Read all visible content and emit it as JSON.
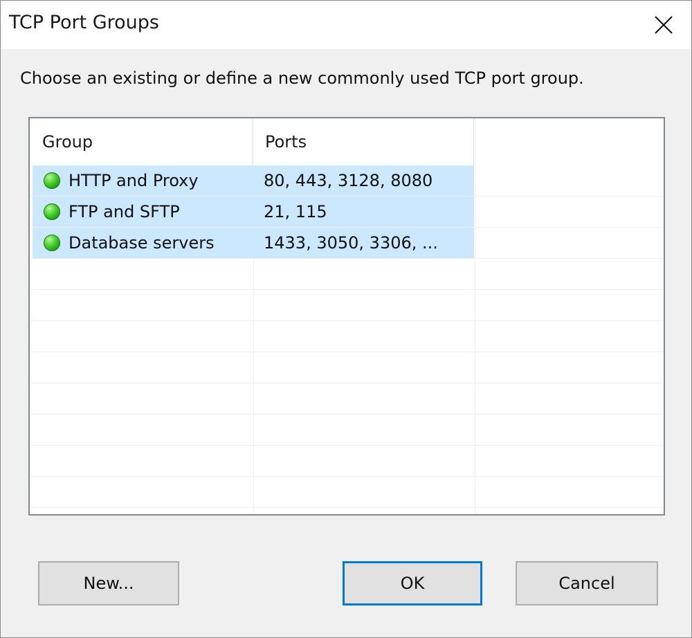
{
  "window": {
    "title": "TCP Port Groups",
    "close_icon": "close-icon"
  },
  "instructions": "Choose an existing or define a new commonly used TCP port group.",
  "list": {
    "columns": [
      "Group",
      "Ports"
    ],
    "rows": [
      {
        "group": "HTTP and Proxy",
        "ports": "80, 443, 3128, 8080",
        "status": "enabled",
        "selected": true
      },
      {
        "group": "FTP and SFTP",
        "ports": "21, 115",
        "status": "enabled",
        "selected": true
      },
      {
        "group": "Database servers",
        "ports": "1433, 3050, 3306, ...",
        "status": "enabled",
        "selected": true
      }
    ],
    "selection_color": "#cce8ff",
    "status_color": "#3cc021"
  },
  "buttons": {
    "new": "New...",
    "ok": "OK",
    "cancel": "Cancel"
  },
  "colors": {
    "accent": "#0078d7",
    "button_bg": "#e1e1e1",
    "dialog_bg": "#f0f0f0"
  }
}
